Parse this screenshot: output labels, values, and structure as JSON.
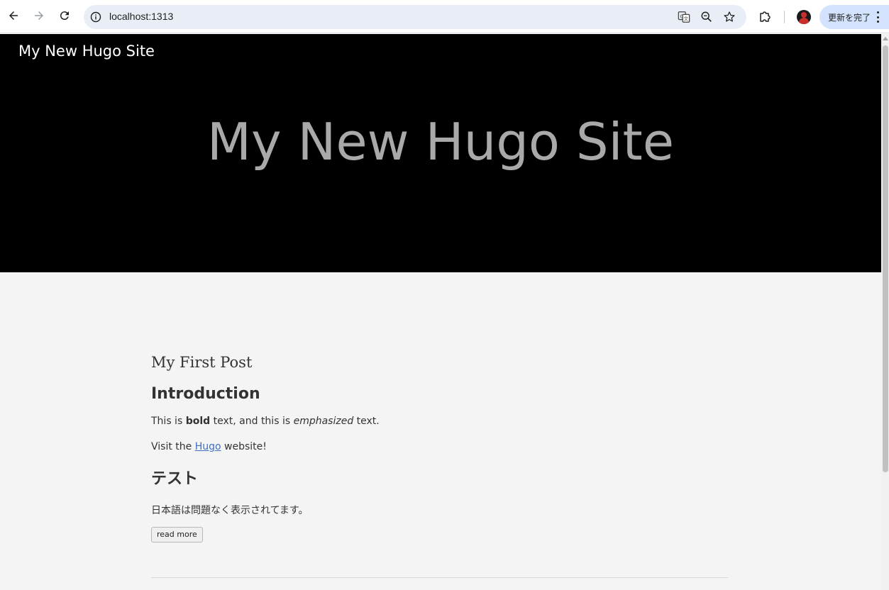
{
  "browser": {
    "url": "localhost:1313",
    "update_label": "更新を完了"
  },
  "site": {
    "brand": "My New Hugo Site",
    "hero_title": "My New Hugo Site"
  },
  "post": {
    "title": "My First Post",
    "heading1": "Introduction",
    "p1_before": "This is ",
    "p1_bold": "bold",
    "p1_middle": " text, and this is ",
    "p1_em": "emphasized",
    "p1_after": " text.",
    "p2_before": "Visit the ",
    "p2_link": "Hugo",
    "p2_after": " website!",
    "heading2": "テスト",
    "p3": "日本語は問題なく表示されてます。",
    "read_more": "read more"
  }
}
